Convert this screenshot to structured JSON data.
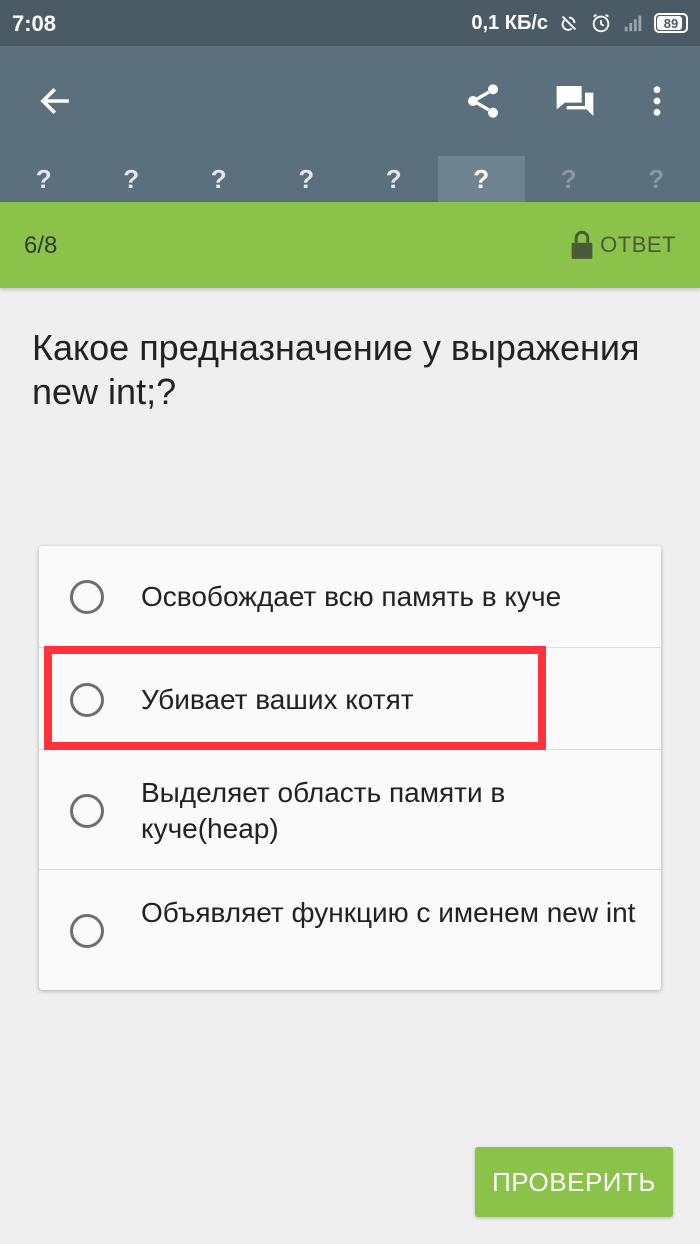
{
  "status_bar": {
    "time": "7:08",
    "network_speed": "0,1 КБ/с",
    "battery": "89"
  },
  "toolbar": {
    "back_icon": "arrow-back-icon",
    "share_icon": "share-icon",
    "comments_icon": "comments-icon",
    "menu_icon": "more-vert-icon"
  },
  "progress_tabs": [
    {
      "label": "?",
      "state": "answered"
    },
    {
      "label": "?",
      "state": "answered"
    },
    {
      "label": "?",
      "state": "answered"
    },
    {
      "label": "?",
      "state": "answered"
    },
    {
      "label": "?",
      "state": "answered"
    },
    {
      "label": "?",
      "state": "current"
    },
    {
      "label": "?",
      "state": "pending"
    },
    {
      "label": "?",
      "state": "pending"
    }
  ],
  "quiz": {
    "counter": "6/8",
    "answer_label": "ОТВЕТ",
    "question": "Какое предназначение у выражения new int;?",
    "options": [
      {
        "text": "Освобождает всю память в куче"
      },
      {
        "text": "Убивает ваших котят"
      },
      {
        "text": "Выделяет область памяти в куче(heap)"
      },
      {
        "text": "Объявляет функцию с именем new int"
      }
    ],
    "check_button": "ПРОВЕРИТЬ"
  },
  "colors": {
    "toolbar": "#5b6f7d",
    "accent_green": "#8bc34a",
    "highlight_red": "#ff333b"
  }
}
